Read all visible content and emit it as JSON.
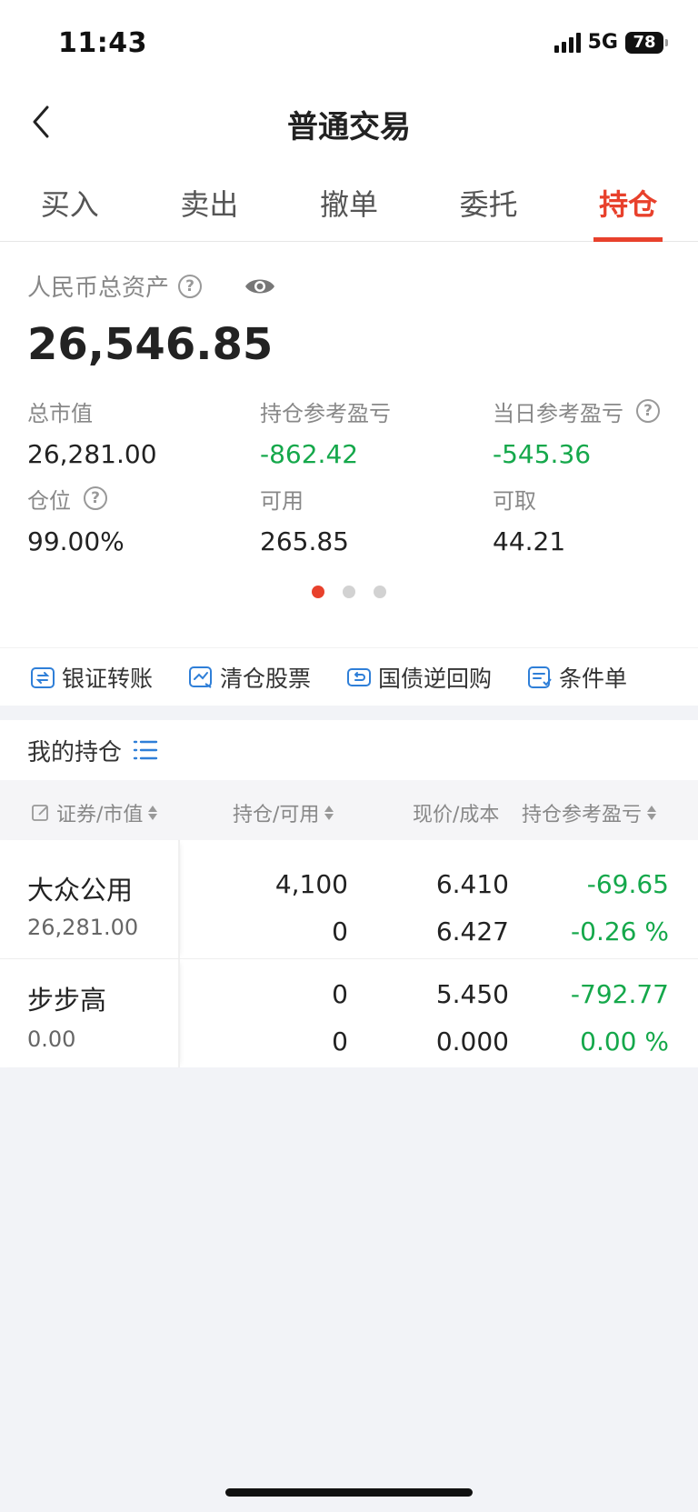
{
  "status": {
    "time": "11:43",
    "network": "5G",
    "battery": "78"
  },
  "nav": {
    "title": "普通交易"
  },
  "tabs": [
    {
      "label": "买入"
    },
    {
      "label": "卖出"
    },
    {
      "label": "撤单"
    },
    {
      "label": "委托"
    },
    {
      "label": "持仓",
      "active": true
    }
  ],
  "assets": {
    "label": "人民币总资产",
    "total": "26,546.85",
    "stats": [
      {
        "label": "总市值",
        "value": "26,281.00"
      },
      {
        "label": "持仓参考盈亏",
        "value": "-862.42"
      },
      {
        "label": "当日参考盈亏",
        "value": "-545.36"
      },
      {
        "label": "仓位",
        "value": "99.00%"
      },
      {
        "label": "可用",
        "value": "265.85"
      },
      {
        "label": "可取",
        "value": "44.21"
      }
    ],
    "page_indicator": {
      "current": 1,
      "total": 3
    }
  },
  "quick_actions": [
    {
      "label": "银证转账",
      "icon": "bank-transfer-icon"
    },
    {
      "label": "清仓股票",
      "icon": "clear-position-icon"
    },
    {
      "label": "国债逆回购",
      "icon": "bond-repo-icon"
    },
    {
      "label": "条件单",
      "icon": "condition-order-icon"
    }
  ],
  "holdings": {
    "title": "我的持仓",
    "columns": [
      "证券/市值",
      "持仓/可用",
      "现价/成本",
      "持仓参考盈亏"
    ],
    "rows": [
      {
        "name": "大众公用",
        "market_value": "26,281.00",
        "position": "4,100",
        "available": "0",
        "price": "6.410",
        "cost": "6.427",
        "pnl": "-69.65",
        "pnl_pct": "-0.26 %"
      },
      {
        "name": "步步高",
        "market_value": "0.00",
        "position": "0",
        "available": "0",
        "price": "5.450",
        "cost": "0.000",
        "pnl": "-792.77",
        "pnl_pct": "0.00 %"
      }
    ]
  },
  "colors": {
    "accent": "#e8412c",
    "loss": "#15a84b",
    "link_blue": "#2f7fd8"
  }
}
